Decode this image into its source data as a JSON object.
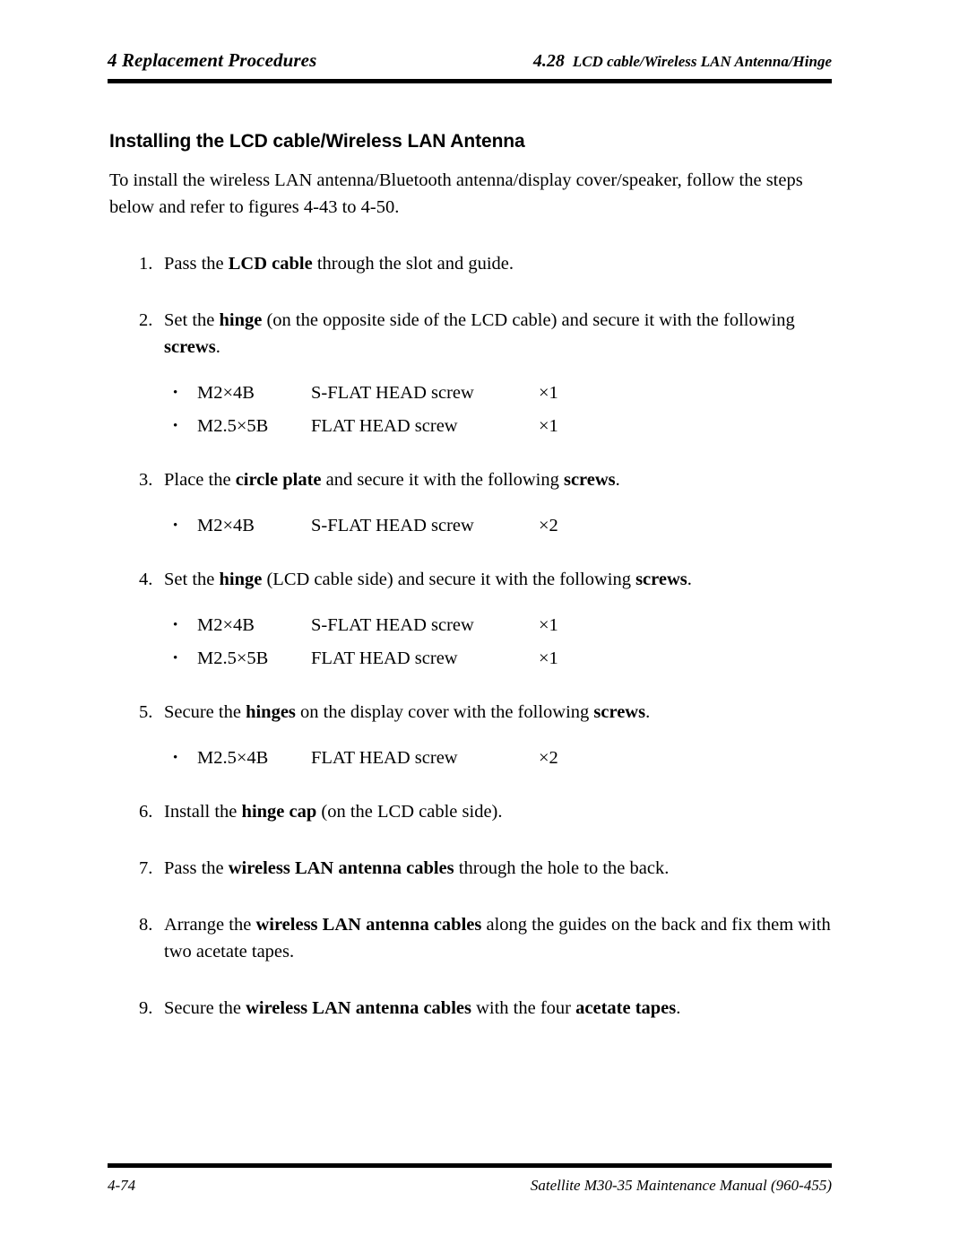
{
  "header": {
    "left_title": "4 Replacement Procedures",
    "section_number": "4.28",
    "section_title": "LCD cable/Wireless LAN Antenna/Hinge"
  },
  "section_title": "Installing the LCD cable/Wireless LAN Antenna",
  "intro": "To install the wireless LAN antenna/Bluetooth antenna/display cover/speaker, follow the steps below and refer to figures 4-43 to 4-50.",
  "steps": [
    {
      "number": "1.",
      "text_html": "Pass the <b>LCD cable</b> through the slot and guide.",
      "screws": []
    },
    {
      "number": "2.",
      "text_html": "Set the <b>hinge</b> (on the opposite side of the LCD cable) and secure it with the following <b>screws</b>.",
      "screws": [
        {
          "bullet": "•",
          "size": "M2×4B",
          "kind": "S-FLAT HEAD screw",
          "qty": "×1"
        },
        {
          "bullet": "•",
          "size": "M2.5×5B",
          "kind": "FLAT HEAD screw",
          "qty": "×1"
        }
      ]
    },
    {
      "number": "3.",
      "text_html": "Place the <b>circle plate</b> and secure it with the following <b>screws</b>.",
      "screws": [
        {
          "bullet": "•",
          "size": "M2×4B",
          "kind": "S-FLAT HEAD screw",
          "qty": "×2"
        }
      ]
    },
    {
      "number": "4.",
      "text_html": "Set the <b>hinge</b> (LCD cable side) and secure it with the following <b>screws</b>.",
      "screws": [
        {
          "bullet": "•",
          "size": "M2×4B",
          "kind": "S-FLAT HEAD screw",
          "qty": "×1"
        },
        {
          "bullet": "•",
          "size": "M2.5×5B",
          "kind": "FLAT HEAD screw",
          "qty": "×1"
        }
      ]
    },
    {
      "number": "5.",
      "text_html": "Secure the <b>hinges</b> on the display cover with the following <b>screws</b>.",
      "screws": [
        {
          "bullet": "•",
          "size": "M2.5×4B",
          "kind": "FLAT HEAD screw",
          "qty": "×2"
        }
      ]
    },
    {
      "number": "6.",
      "text_html": "Install the <b>hinge cap</b> (on the LCD cable side).",
      "screws": []
    },
    {
      "number": "7.",
      "text_html": "Pass the <b>wireless LAN antenna cables</b> through the hole to the back.",
      "screws": []
    },
    {
      "number": "8.",
      "text_html": "Arrange the <b>wireless LAN antenna cables</b> along the guides on the back and fix them with two acetate tapes.",
      "screws": []
    },
    {
      "number": "9.",
      "text_html": "Secure the <b>wireless LAN antenna cables</b> with the four <b>acetate tapes</b>.",
      "screws": []
    }
  ],
  "footer": {
    "page_number": "4-74",
    "manual_title": "Satellite M30-35 Maintenance Manual (960-455)"
  }
}
